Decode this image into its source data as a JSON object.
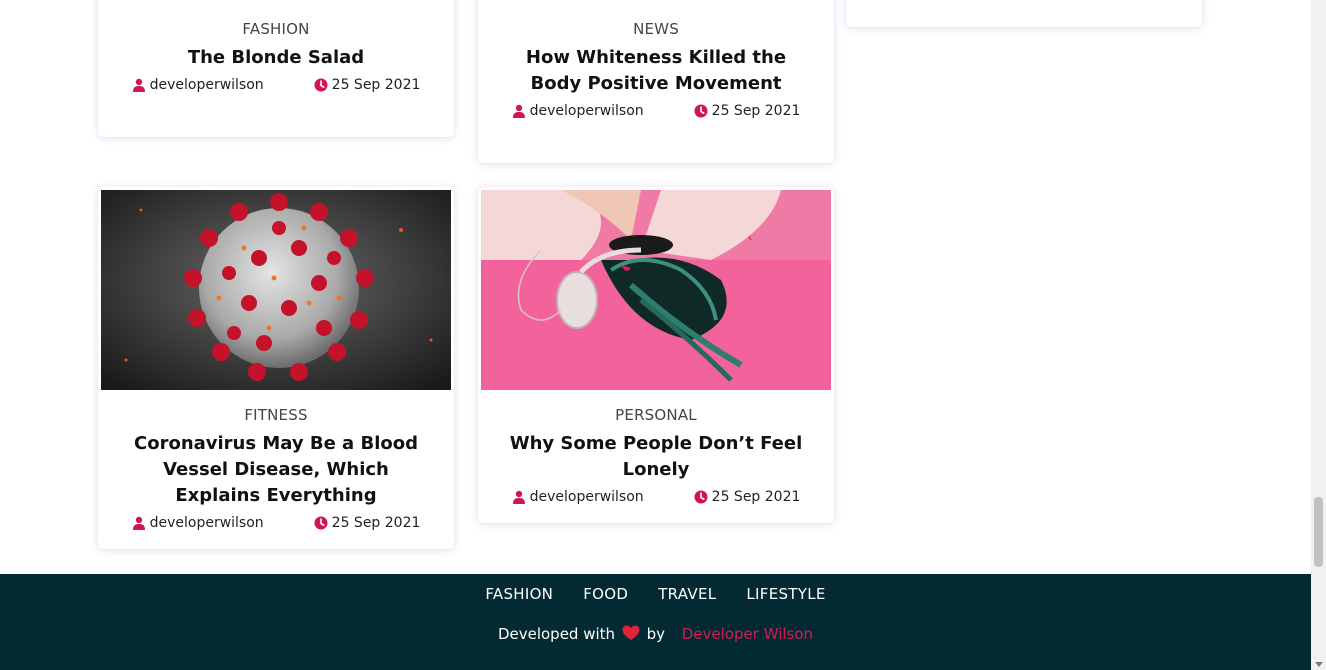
{
  "posts": [
    {
      "category": "FASHION",
      "title": "The Blonde Salad",
      "author": "developerwilson",
      "date": "25 Sep 2021"
    },
    {
      "category": "NEWS",
      "title": "How Whiteness Killed the Body Positive Movement",
      "author": "developerwilson",
      "date": "25 Sep 2021"
    },
    {
      "category": "FITNESS",
      "title": "Coronavirus May Be a Blood Vessel Disease, Which Explains Everything",
      "author": "developerwilson",
      "date": "25 Sep 2021"
    },
    {
      "category": "PERSONAL",
      "title": "Why Some People Don’t Feel Lonely",
      "author": "developerwilson",
      "date": "25 Sep 2021"
    }
  ],
  "footer": {
    "nav": [
      "FASHION",
      "FOOD",
      "TRAVEL",
      "LIFESTYLE"
    ],
    "credit_prefix": "Developed with",
    "credit_by": "by",
    "credit_name": "Developer Wilson"
  },
  "colors": {
    "accent": "#d0145a",
    "footer_bg": "#032a32",
    "credit_link": "#d21d4f"
  },
  "icons": {
    "author": "user-icon",
    "date": "clock-icon",
    "heart": "heart-icon"
  }
}
